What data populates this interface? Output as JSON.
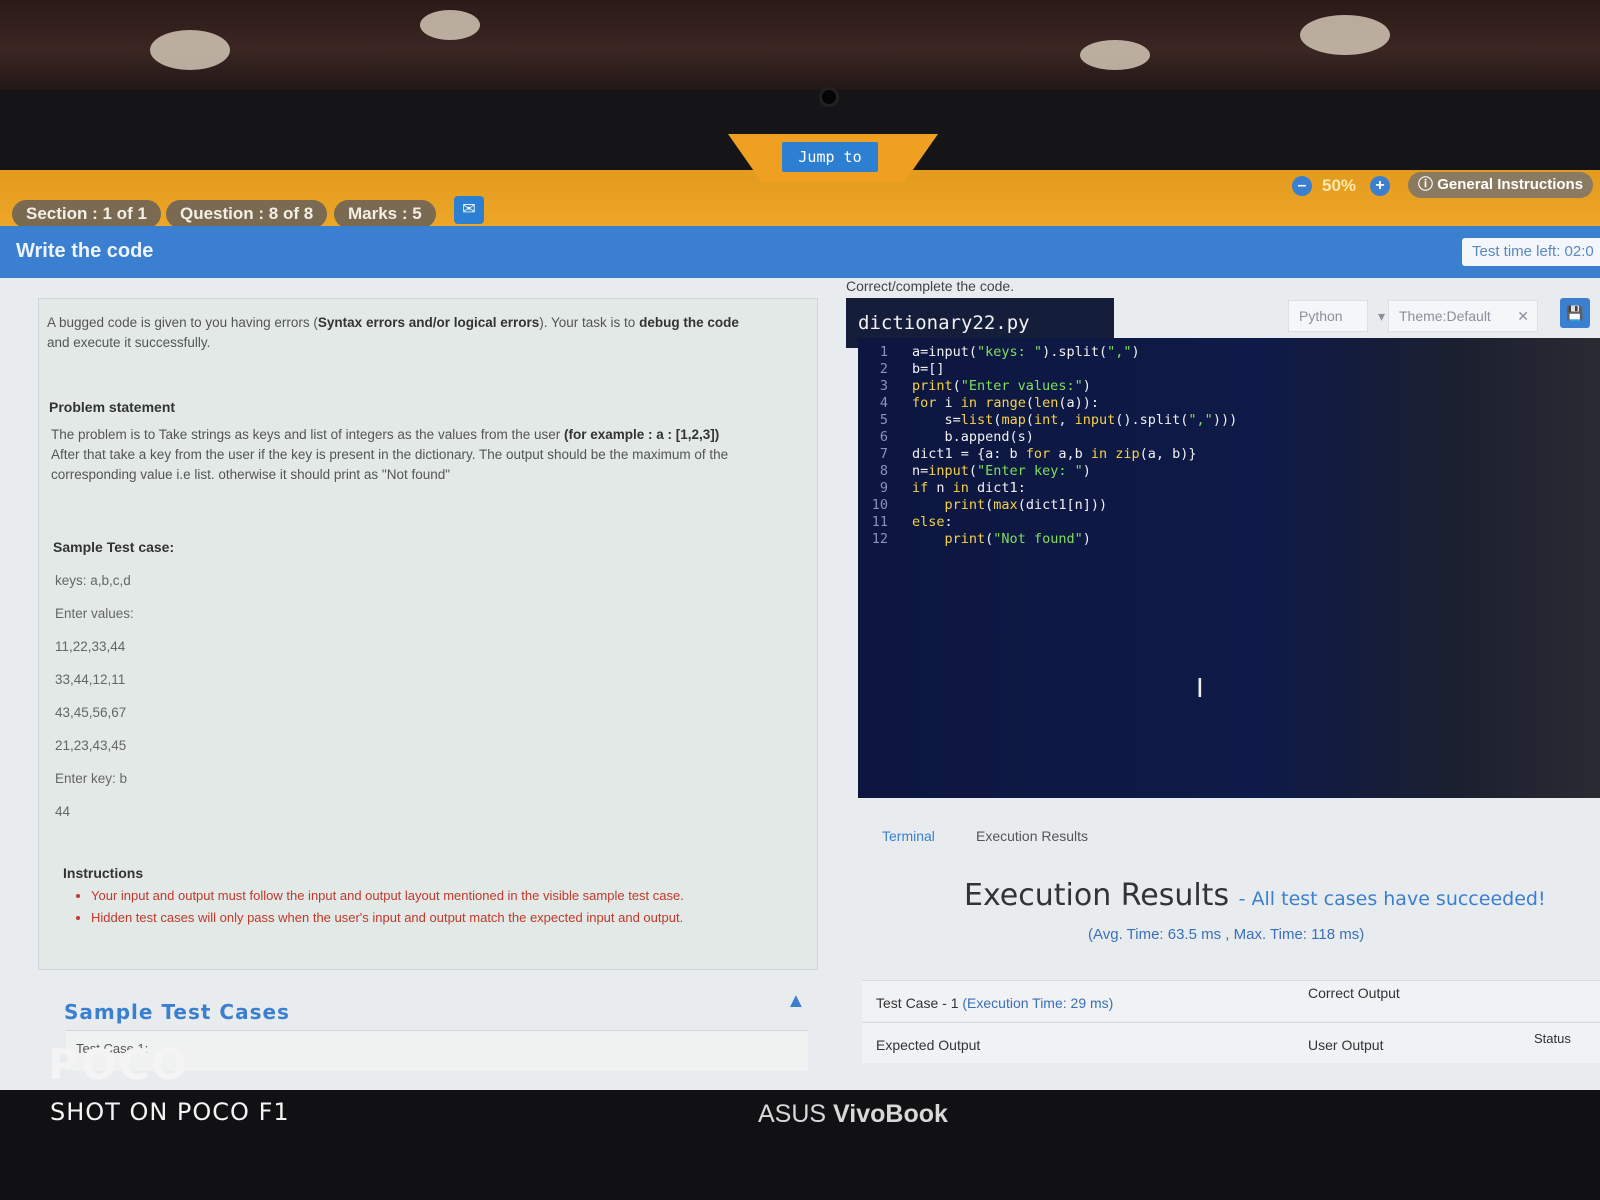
{
  "topbar": {
    "section": "Section : 1 of 1",
    "question": "Question : 8 of 8",
    "marks": "Marks : 5",
    "jump_label": "Jump to",
    "zoom_level": "50%",
    "zoom_out": "–",
    "zoom_in": "+",
    "general_instructions": "General Instructions",
    "time_left": "Test time left: 02:0"
  },
  "header": {
    "title": "Write the code"
  },
  "problem": {
    "intro_1": "A bugged code is given to you having errors (",
    "intro_bold_1": "Syntax errors and/or logical errors",
    "intro_2": "). Your task is to ",
    "intro_bold_2": "debug the code",
    "intro_3": "and execute it successfully.",
    "statement_heading": "Problem statement",
    "statement_1": "The problem is to Take strings as keys and list of integers as the values from the user ",
    "statement_bold": "(for example : a : [1,2,3])",
    "statement_2": "After that take a key from the user if the key is present in the dictionary. The output should be the maximum of the",
    "statement_3": "corresponding value i.e list. otherwise it should print as \"Not found\"",
    "sample_heading": "Sample Test case:",
    "sample_lines": [
      "keys: a,b,c,d",
      "Enter values:",
      "11,22,33,44",
      "33,44,12,11",
      "43,45,56,67",
      "21,23,43,45",
      "Enter key: b",
      "44"
    ],
    "instructions_heading": "Instructions",
    "instructions": [
      "Your input and output must follow the input and output layout mentioned in the visible sample test case.",
      "Hidden test cases will only pass when the user's input and output match the expected input and output."
    ]
  },
  "sample_cases": {
    "title": "Sample Test Cases",
    "first": "Test Case 1:"
  },
  "editor": {
    "instruction": "Correct/complete the code.",
    "filename": "dictionary22.py",
    "language": "Python",
    "theme": "Theme:Default",
    "lines": [
      "a=input(\"keys: \").split(\",\")",
      "b=[]",
      "print(\"Enter values:\")",
      "for i in range(len(a)):",
      "    s=list(map(int, input().split(\",\")))",
      "    b.append(s)",
      "dict1 = {a: b for a,b in zip(a, b)}",
      "n=input(\"Enter key: \")",
      "if n in dict1:",
      "    print(max(dict1[n]))",
      "else:",
      "    print(\"Not found\")"
    ]
  },
  "results": {
    "tab_terminal": "Terminal",
    "tab_execution": "Execution Results",
    "title": "Execution Results",
    "subtitle": "- All test cases have succeeded!",
    "timing": "(Avg. Time: 63.5 ms , Max. Time: 118 ms)",
    "case_label": "Test Case - 1",
    "case_time": "(Execution Time: 29 ms)",
    "correct_output": "Correct Output",
    "expected_output": "Expected Output",
    "user_output": "User Output",
    "status": "Status"
  },
  "device": {
    "laptop_brand": "ASUS",
    "laptop_model": "VivoBook",
    "camera_brand": "POCO",
    "camera_caption": "SHOT ON POCO F1"
  },
  "colors": {
    "orange": "#f0a82a",
    "blue": "#3a7fd0",
    "editor_bg": "#0f1a48"
  }
}
